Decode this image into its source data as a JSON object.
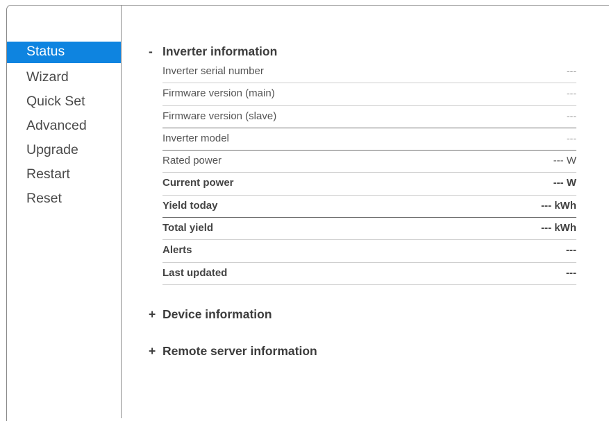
{
  "nav": {
    "items": [
      {
        "label": "Status",
        "active": true
      },
      {
        "label": "Wizard",
        "active": false
      },
      {
        "label": "Quick Set",
        "active": false
      },
      {
        "label": "Advanced",
        "active": false
      },
      {
        "label": "Upgrade",
        "active": false
      },
      {
        "label": "Restart",
        "active": false
      },
      {
        "label": "Reset",
        "active": false
      }
    ]
  },
  "inverter": {
    "sign": "-",
    "title": "Inverter information",
    "rows": [
      {
        "label": "Inverter serial number",
        "value": "---"
      },
      {
        "label": "Firmware version (main)",
        "value": "---"
      },
      {
        "label": "Firmware version (slave)",
        "value": "---"
      },
      {
        "label": "Inverter model",
        "value": "---"
      },
      {
        "label": "Rated power",
        "value": "--- W"
      },
      {
        "label": "Current power",
        "value": "--- W"
      },
      {
        "label": "Yield today",
        "value": "--- kWh"
      },
      {
        "label": "Total yield",
        "value": "--- kWh"
      },
      {
        "label": "Alerts",
        "value": "---"
      },
      {
        "label": "Last updated",
        "value": "---"
      }
    ]
  },
  "device": {
    "sign": "+",
    "title": "Device information"
  },
  "remote": {
    "sign": "+",
    "title": "Remote server information"
  },
  "colors": {
    "accent": "#0e84e0"
  }
}
